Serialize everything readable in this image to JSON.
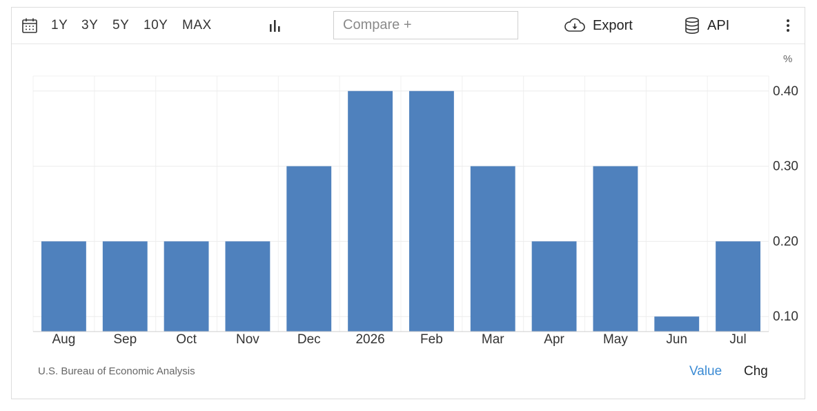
{
  "toolbar": {
    "calendar_icon": "calendar-icon",
    "ranges": [
      "1Y",
      "3Y",
      "5Y",
      "10Y",
      "MAX"
    ],
    "chart_type_icon": "bar-chart-icon",
    "compare_placeholder": "Compare +",
    "export_label": "Export",
    "export_icon": "cloud-download-icon",
    "api_label": "API",
    "api_icon": "database-icon",
    "more_icon": "more-vertical-icon"
  },
  "footer": {
    "source": "U.S. Bureau of Economic Analysis",
    "value_label": "Value",
    "chg_label": "Chg",
    "active_color": "#3b8bd4"
  },
  "chart_data": {
    "type": "bar",
    "unit": "%",
    "categories": [
      "Aug",
      "Sep",
      "Oct",
      "Nov",
      "Dec",
      "2026",
      "Feb",
      "Mar",
      "Apr",
      "May",
      "Jun",
      "Jul"
    ],
    "values": [
      0.2,
      0.2,
      0.2,
      0.2,
      0.3,
      0.4,
      0.4,
      0.3,
      0.2,
      0.3,
      0.1,
      0.2
    ],
    "ylim": [
      0.08,
      0.42
    ],
    "yticks": [
      0.1,
      0.2,
      0.3,
      0.4
    ],
    "ytick_labels": [
      "0.10",
      "0.20",
      "0.30",
      "0.40"
    ],
    "y_axis_side": "right",
    "grid": true,
    "bar_color": "#4f81bd"
  }
}
